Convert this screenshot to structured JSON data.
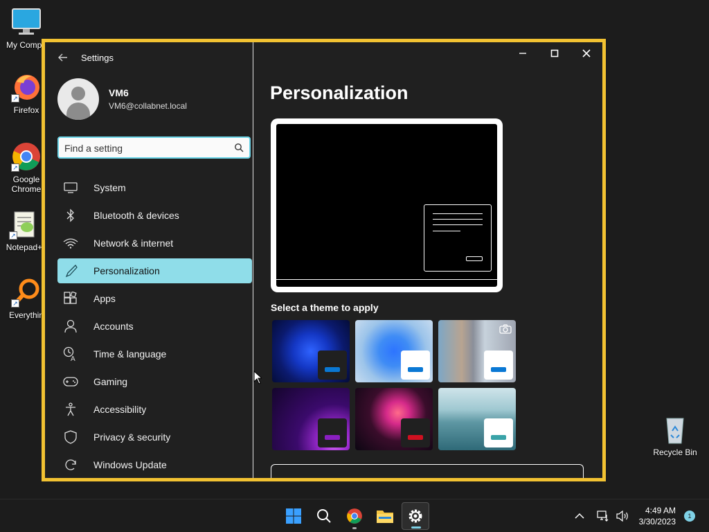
{
  "desktop": {
    "icons": [
      {
        "label": "My Compu"
      },
      {
        "label": "Firefox"
      },
      {
        "label": "Google Chrome"
      },
      {
        "label": "Notepad+"
      },
      {
        "label": "Everythin"
      },
      {
        "label": "Recycle Bin"
      }
    ]
  },
  "window": {
    "title": "Settings",
    "controls": {
      "minimize": "–",
      "maximize": "□",
      "close": "✕"
    }
  },
  "profile": {
    "name": "VM6",
    "email": "VM6@collabnet.local"
  },
  "search": {
    "placeholder": "Find a setting",
    "value": ""
  },
  "sidebar": {
    "items": [
      {
        "label": "System",
        "icon": "monitor-icon"
      },
      {
        "label": "Bluetooth & devices",
        "icon": "bluetooth-icon"
      },
      {
        "label": "Network & internet",
        "icon": "wifi-icon"
      },
      {
        "label": "Personalization",
        "icon": "brush-icon",
        "active": true
      },
      {
        "label": "Apps",
        "icon": "apps-icon"
      },
      {
        "label": "Accounts",
        "icon": "person-icon"
      },
      {
        "label": "Time & language",
        "icon": "globe-clock-icon"
      },
      {
        "label": "Gaming",
        "icon": "gamepad-icon"
      },
      {
        "label": "Accessibility",
        "icon": "accessibility-icon"
      },
      {
        "label": "Privacy & security",
        "icon": "shield-icon"
      },
      {
        "label": "Windows Update",
        "icon": "update-icon"
      }
    ]
  },
  "main": {
    "title": "Personalization",
    "themes_label": "Select a theme to apply",
    "themes": [
      {
        "name": "windows-dark",
        "accent": "#0078d4",
        "chip": "#202020"
      },
      {
        "name": "windows-light",
        "accent": "#0078d4",
        "chip": "#ffffff"
      },
      {
        "name": "windows-spotlight",
        "accent": "#0078d4",
        "chip": "#ffffff"
      },
      {
        "name": "glow",
        "accent": "#8a1fc1",
        "chip": "#202020"
      },
      {
        "name": "captured-motion",
        "accent": "#d01020",
        "chip": "#202020"
      },
      {
        "name": "flow",
        "accent": "#3aa3a8",
        "chip": "#ffffff"
      }
    ]
  },
  "taskbar": {
    "apps": [
      "start-icon",
      "search-icon",
      "chrome-icon",
      "file-explorer-icon",
      "settings-icon"
    ],
    "time": "4:49 AM",
    "date": "3/30/2023",
    "notifications": "1"
  },
  "colors": {
    "window_border": "#f2c232",
    "active_nav": "#8fdde9",
    "search_border": "#6bd5e8"
  }
}
